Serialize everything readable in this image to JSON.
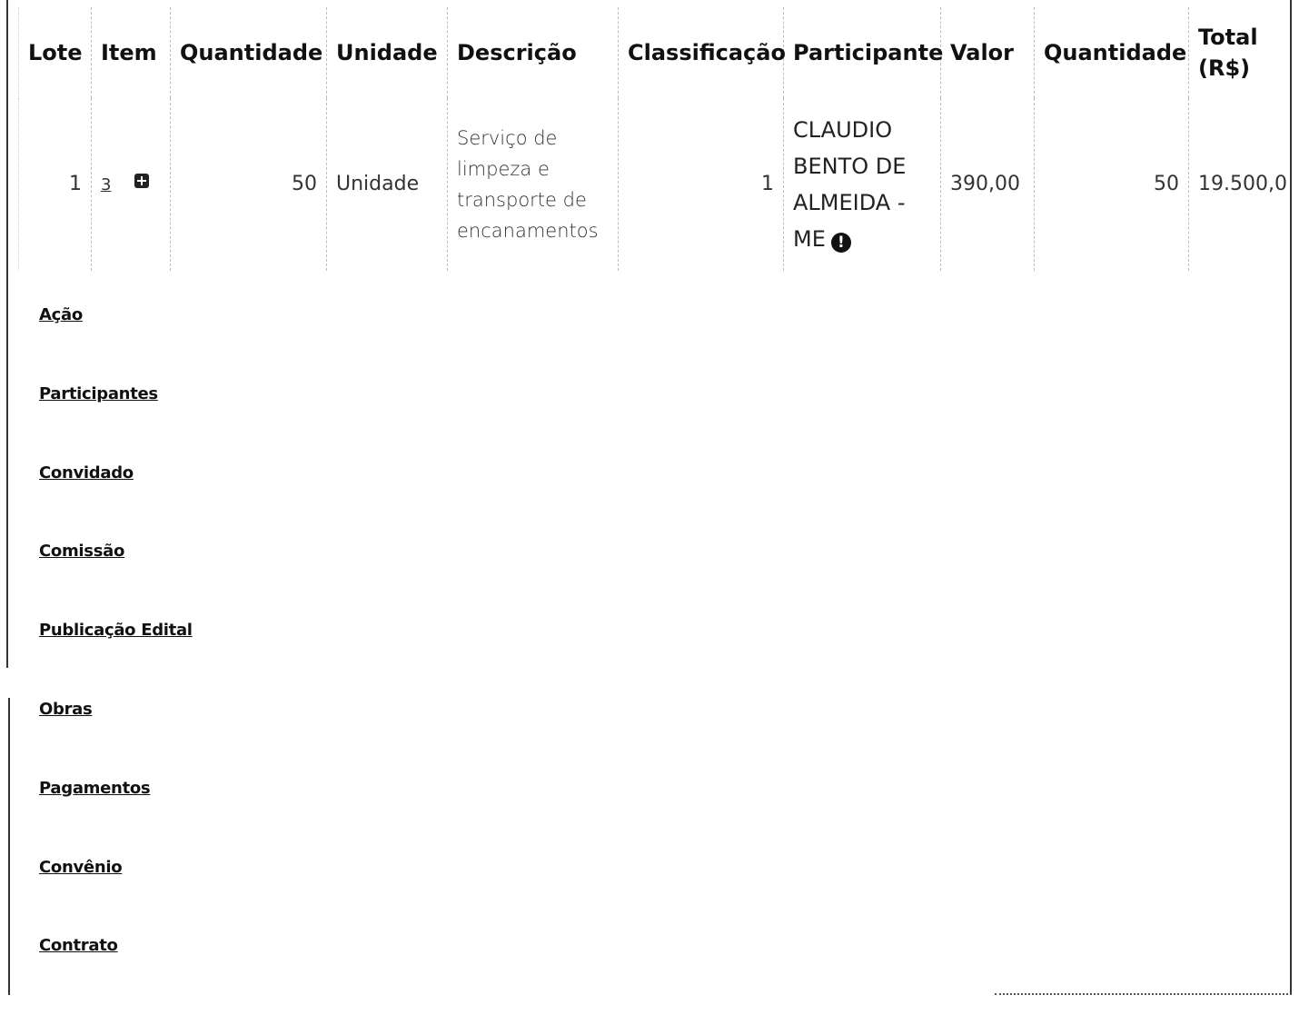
{
  "table": {
    "headers": [
      "Lote",
      "Item",
      "Quantidade",
      "Unidade",
      "Descrição",
      "Classificação",
      "Participante",
      "Valor",
      "Quantidade",
      "Total (R$)"
    ],
    "row": {
      "lote": "1",
      "item": "3",
      "quantidade": "50",
      "unidade": "Unidade",
      "descricao": "Serviço de limpeza e transporte de encanamentos",
      "classificacao": "1",
      "participante": "CLAUDIO BENTO DE ALMEIDA - ME",
      "valor": "390,00",
      "quantidade2": "50",
      "total": "19.500,0"
    },
    "icons": {
      "item_expand": "plus-square-icon",
      "participant_alert": "exclamation-circle-icon"
    }
  },
  "nav": {
    "links": [
      "Ação",
      "Participantes",
      "Convidado",
      "Comissão",
      "Publicação Edital",
      "Obras",
      "Pagamentos",
      "Convênio",
      "Contrato"
    ]
  }
}
